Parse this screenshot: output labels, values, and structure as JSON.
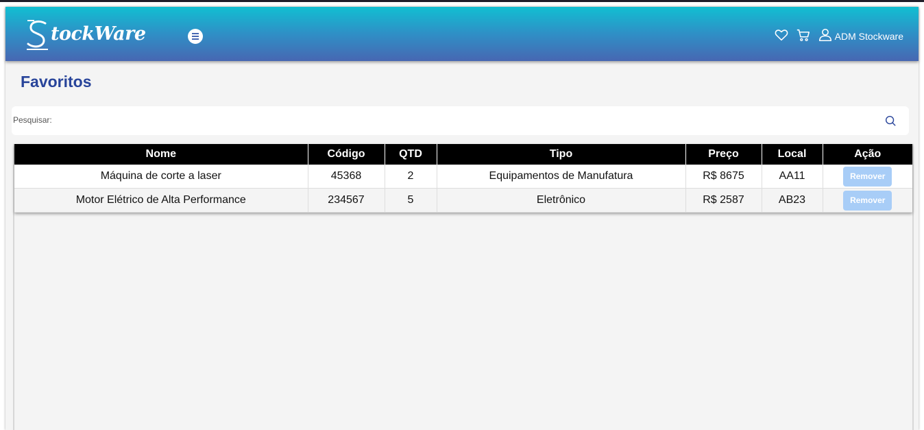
{
  "brand": {
    "logo_text": "tockWare"
  },
  "header": {
    "user_name": "ADM Stockware"
  },
  "page": {
    "title": "Favoritos"
  },
  "search": {
    "label": "Pesquisar:",
    "value": ""
  },
  "table": {
    "columns": [
      "Nome",
      "Código",
      "QTD",
      "Tipo",
      "Preço",
      "Local",
      "Ação"
    ],
    "rows": [
      {
        "nome": "Máquina de corte a laser",
        "codigo": "45368",
        "qtd": "2",
        "tipo": "Equipamentos de Manufatura",
        "preco": "R$ 8675",
        "local": "AA11",
        "action": "Remover"
      },
      {
        "nome": "Motor Elétrico de Alta Performance",
        "codigo": "234567",
        "qtd": "5",
        "tipo": "Eletrônico",
        "preco": "R$ 2587",
        "local": "AB23",
        "action": "Remover"
      }
    ]
  },
  "colors": {
    "header_gradient_top": "#11bfd2",
    "header_gradient_bottom": "#4767b2",
    "title": "#28449a",
    "table_header_bg": "#000000",
    "remove_button": "#a8cdf7"
  },
  "icons": [
    "stockware-logo-icon",
    "menu-icon",
    "heart-icon",
    "cart-icon",
    "user-icon",
    "search-icon"
  ]
}
